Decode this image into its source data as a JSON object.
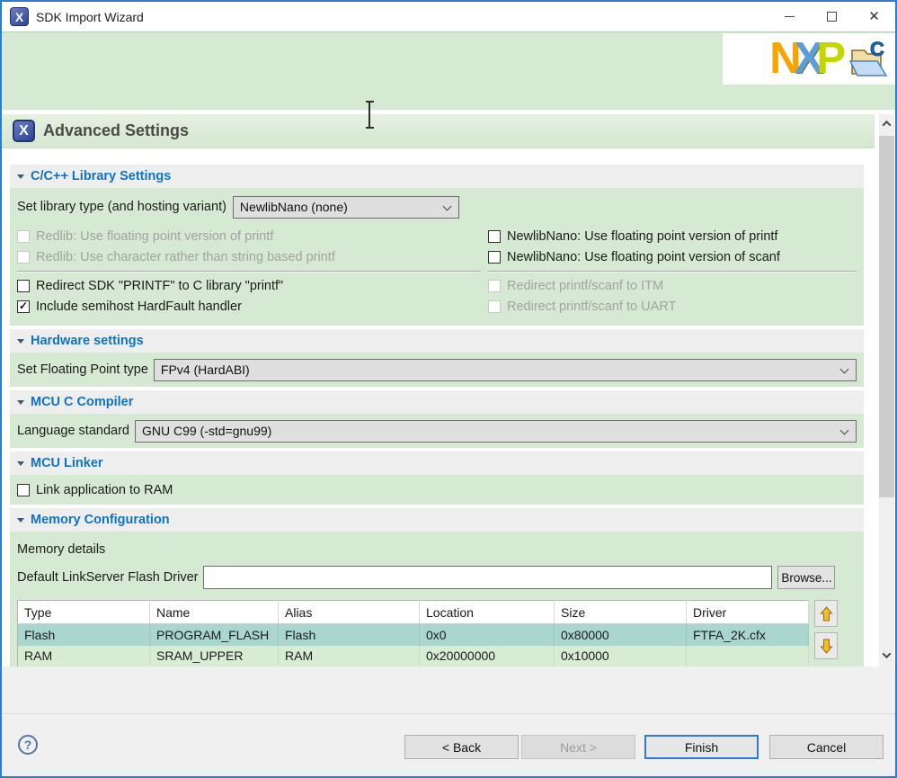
{
  "window": {
    "title": "SDK Import Wizard",
    "app_icon_glyph": "X"
  },
  "logo": {
    "n": "N",
    "x": "X",
    "p": "P",
    "c": "C"
  },
  "header": {
    "title": "Advanced Settings",
    "icon_glyph": "X"
  },
  "library": {
    "title": "C/C++ Library Settings",
    "type_label": "Set library type (and hosting variant)",
    "type_value": "NewlibNano (none)",
    "left": [
      {
        "label": "Redlib: Use floating point version of printf"
      },
      {
        "label": "Redlib: Use character rather than string based printf"
      },
      {
        "label": "Redirect SDK \"PRINTF\" to C library \"printf\""
      },
      {
        "label": "Include semihost HardFault handler"
      }
    ],
    "right": [
      {
        "label": "NewlibNano: Use floating point version of printf"
      },
      {
        "label": "NewlibNano: Use floating point version of scanf"
      },
      {
        "label": "Redirect printf/scanf to ITM"
      },
      {
        "label": "Redirect printf/scanf to UART"
      }
    ]
  },
  "hardware": {
    "title": "Hardware settings",
    "fp_label": "Set Floating Point type",
    "fp_value": "FPv4 (HardABI)"
  },
  "compiler": {
    "title": "MCU C Compiler",
    "std_label": "Language standard",
    "std_value": "GNU C99 (-std=gnu99)"
  },
  "linker": {
    "title": "MCU Linker",
    "ram_label": "Link application to RAM"
  },
  "memory": {
    "title": "Memory Configuration",
    "details_label": "Memory details",
    "driver_label": "Default LinkServer Flash Driver",
    "driver_value": "",
    "browse_label": "Browse...",
    "table": {
      "headers": [
        "Type",
        "Name",
        "Alias",
        "Location",
        "Size",
        "Driver"
      ],
      "rows": [
        [
          "Flash",
          "PROGRAM_FLASH",
          "Flash",
          "0x0",
          "0x80000",
          "FTFA_2K.cfx"
        ],
        [
          "RAM",
          "SRAM_UPPER",
          "RAM",
          "0x20000000",
          "0x10000",
          ""
        ]
      ]
    }
  },
  "footer": {
    "help_glyph": "?",
    "back": "< Back",
    "next": "Next >",
    "finish": "Finish",
    "cancel": "Cancel"
  },
  "colors": {
    "window_border": "#2e7cd0",
    "panel_green": "#d6e9d2",
    "section_title_blue": "#0c74c8",
    "selection_teal": "#a9d6ce",
    "nxp_orange": "#f7a400",
    "nxp_blue": "#5e9dd6",
    "nxp_green": "#c4d600"
  }
}
